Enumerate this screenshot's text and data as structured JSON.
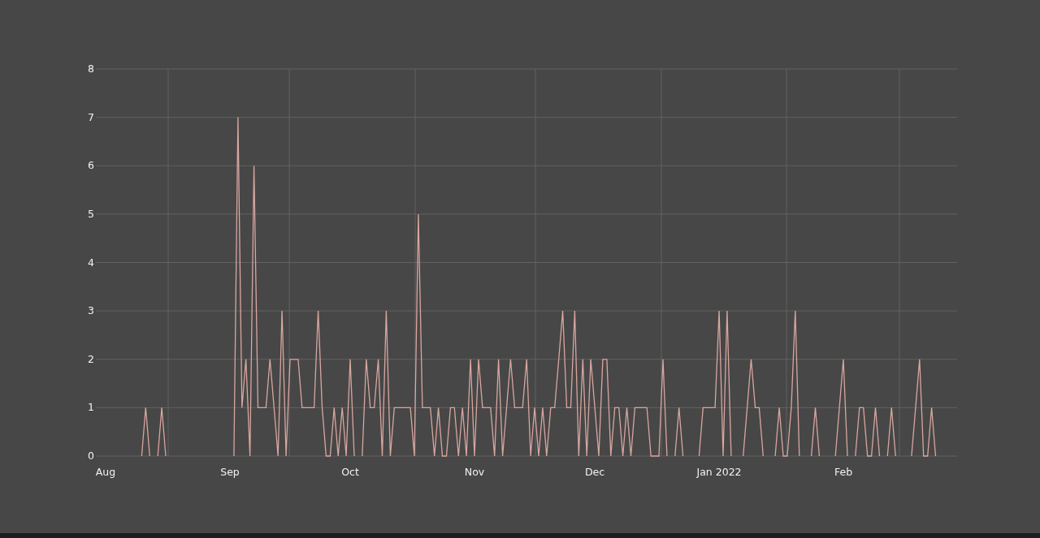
{
  "chart_data": {
    "type": "line",
    "grid": true,
    "ylim": [
      0,
      8
    ],
    "yticks": [
      0,
      1,
      2,
      3,
      4,
      5,
      6,
      7,
      8
    ],
    "categories": [
      "Aug",
      null,
      null,
      null,
      null,
      null,
      null,
      null,
      null,
      null,
      null,
      null,
      null,
      null,
      null,
      null,
      null,
      null,
      null,
      null,
      null,
      null,
      null,
      null,
      null,
      null,
      null,
      null,
      null,
      null,
      null,
      "Sep",
      null,
      null,
      null,
      null,
      null,
      null,
      null,
      null,
      null,
      null,
      null,
      null,
      null,
      null,
      null,
      null,
      null,
      null,
      null,
      null,
      null,
      null,
      null,
      null,
      null,
      null,
      null,
      null,
      null,
      "Oct",
      null,
      null,
      null,
      null,
      null,
      null,
      null,
      null,
      null,
      null,
      null,
      null,
      null,
      null,
      null,
      null,
      null,
      null,
      null,
      null,
      null,
      null,
      null,
      null,
      null,
      null,
      null,
      null,
      null,
      null,
      "Nov",
      null,
      null,
      null,
      null,
      null,
      null,
      null,
      null,
      null,
      null,
      null,
      null,
      null,
      null,
      null,
      null,
      null,
      null,
      null,
      null,
      null,
      null,
      null,
      null,
      null,
      null,
      null,
      null,
      null,
      "Dec",
      null,
      null,
      null,
      null,
      null,
      null,
      null,
      null,
      null,
      null,
      null,
      null,
      null,
      null,
      null,
      null,
      null,
      null,
      null,
      null,
      null,
      null,
      null,
      null,
      null,
      null,
      null,
      null,
      null,
      null,
      "Jan 2022",
      null,
      null,
      null,
      null,
      null,
      null,
      null,
      null,
      null,
      null,
      null,
      null,
      null,
      null,
      null,
      null,
      null,
      null,
      null,
      null,
      null,
      null,
      null,
      null,
      null,
      null,
      null,
      null,
      null,
      null,
      "Feb",
      null,
      null,
      null,
      null,
      null,
      null,
      null,
      null,
      null,
      null,
      null,
      null,
      null,
      null,
      null,
      null,
      null,
      null,
      null,
      null,
      null,
      null,
      null
    ],
    "series": [
      {
        "color": "#d9a6a0",
        "values": [
          null,
          null,
          null,
          null,
          null,
          null,
          null,
          null,
          null,
          0,
          1,
          0,
          null,
          0,
          1,
          0,
          null,
          null,
          null,
          null,
          null,
          null,
          null,
          null,
          null,
          null,
          null,
          null,
          null,
          null,
          null,
          null,
          0,
          7,
          1,
          2,
          0,
          6,
          1,
          1,
          1,
          2,
          1,
          0,
          3,
          0,
          2,
          2,
          2,
          1,
          1,
          1,
          1,
          3,
          1,
          0,
          0,
          1,
          0,
          1,
          0,
          2,
          0,
          null,
          0,
          2,
          1,
          1,
          2,
          0,
          3,
          0,
          1,
          1,
          1,
          1,
          1,
          0,
          5,
          1,
          1,
          1,
          0,
          1,
          0,
          0,
          1,
          1,
          0,
          1,
          0,
          2,
          0,
          2,
          1,
          1,
          1,
          0,
          2,
          0,
          1,
          2,
          1,
          1,
          1,
          2,
          0,
          1,
          0,
          1,
          0,
          1,
          1,
          2,
          3,
          1,
          1,
          3,
          0,
          2,
          0,
          2,
          1,
          0,
          2,
          2,
          0,
          1,
          1,
          0,
          1,
          0,
          1,
          1,
          1,
          1,
          0,
          0,
          0,
          2,
          0,
          null,
          0,
          1,
          0,
          null,
          null,
          null,
          0,
          1,
          1,
          1,
          1,
          3,
          0,
          3,
          0,
          null,
          null,
          0,
          1,
          2,
          1,
          1,
          0,
          null,
          null,
          0,
          1,
          0,
          0,
          1,
          3,
          0,
          null,
          null,
          0,
          1,
          0,
          null,
          null,
          null,
          0,
          1,
          2,
          0,
          null,
          0,
          1,
          1,
          0,
          0,
          1,
          0,
          null,
          0,
          1,
          0,
          null,
          null,
          null,
          0,
          1,
          2,
          0,
          0,
          1,
          0
        ]
      }
    ]
  }
}
